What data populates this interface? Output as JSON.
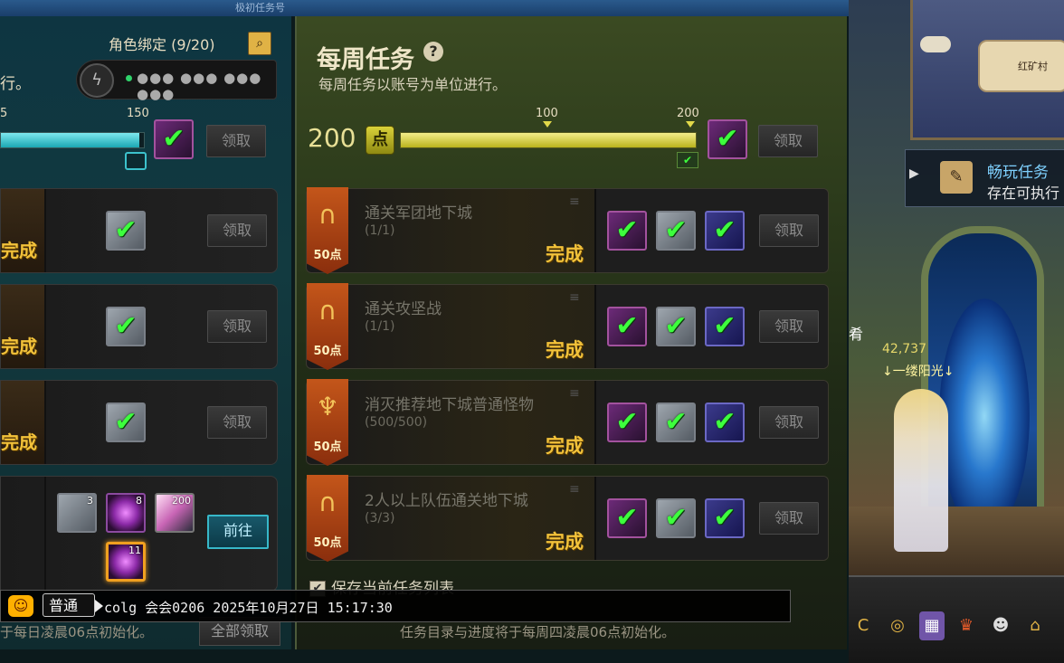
{
  "scene": {
    "top_title": "极初任务号"
  },
  "left_panel": {
    "bind_label": "角色绑定 (9/20)",
    "partial_text": "行。",
    "code_masked": "●●● ●●● ●●● ●●●",
    "progress": {
      "tick_left": "5",
      "tick_right": "150",
      "fill_fraction": 0.97,
      "claim_label": "领取"
    },
    "rows": [
      {
        "status": "完成",
        "claim_label": "领取"
      },
      {
        "status": "完成",
        "claim_label": "领取"
      },
      {
        "status": "完成",
        "claim_label": "领取"
      }
    ],
    "reward_row": {
      "items": [
        {
          "icon": "silver-badge-icon",
          "count": "3"
        },
        {
          "icon": "purple-orb-icon",
          "count": "8"
        },
        {
          "icon": "crystal-shard-icon",
          "count": "200"
        },
        {
          "icon": "purple-orb-icon",
          "count": "11"
        }
      ],
      "go_label": "前往"
    },
    "bottom_text": "于每日凌晨06点初始化。",
    "claim_all_label": "全部领取"
  },
  "weekly": {
    "title": "每周任务",
    "help_icon": "?",
    "subtitle": "每周任务以账号为单位进行。",
    "points_value": "200",
    "points_badge": "点",
    "tick_mid": "100",
    "tick_end": "200",
    "fill_fraction": 1.0,
    "claim_label": "领取",
    "quests": [
      {
        "name": "通关军团地下城",
        "progress": "(1/1)",
        "points": "50点",
        "status": "完成",
        "claim_label": "领取",
        "symbol": "∩"
      },
      {
        "name": "通关攻坚战",
        "progress": "(1/1)",
        "points": "50点",
        "status": "完成",
        "claim_label": "领取",
        "symbol": "∩"
      },
      {
        "name": "消灭推荐地下城普通怪物",
        "progress": "(500/500)",
        "points": "50点",
        "status": "完成",
        "claim_label": "领取",
        "symbol": "♆"
      },
      {
        "name": "2人以上队伍通关地下城",
        "progress": "(3/3)",
        "points": "50点",
        "status": "完成",
        "claim_label": "领取",
        "symbol": "∩"
      }
    ],
    "keep_list_label": "保存当前任务列表",
    "bottom_text": "任务目录与进度将于每周四凌晨06点初始化。"
  },
  "right_hud": {
    "map_label": "红矿村",
    "quest_popup_title": "畅玩任务",
    "quest_popup_text": "存在可执行",
    "side_char": "肴",
    "player_power": "42,737",
    "player_name": "↓一缕阳光↓"
  },
  "chat": {
    "emoji_icon": "smiley-icon",
    "channel": "普通",
    "message": "colg 会会0206 2025年10月27日 15:17:30"
  },
  "colors": {
    "accent_cyan": "#1aa7b2",
    "accent_yellow": "#b9b21c",
    "done_gold": "#f2c23a",
    "ribbon_orange": "#c4561a"
  }
}
